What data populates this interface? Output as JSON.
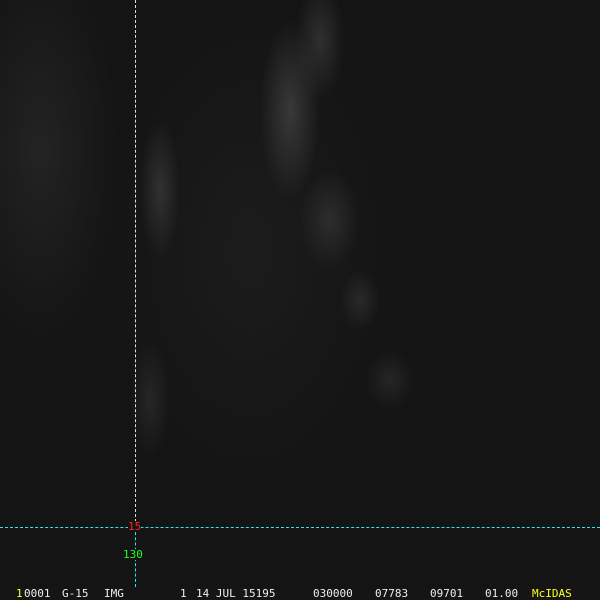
{
  "grid": {
    "latitude_label": "15",
    "longitude_label": "130"
  },
  "status_bar": {
    "frame": "1",
    "image_id": "0001",
    "satellite": "G-15",
    "type": "IMG",
    "band": "1",
    "date": "14 JUL 15195",
    "time": "030000",
    "line": "07783",
    "element": "09701",
    "resolution": "01.00",
    "brand": "McIDAS"
  },
  "colors": {
    "lat": "#ff2222",
    "lon": "#22ff22",
    "grid": "#22eeee",
    "brand": "#ffff22"
  }
}
